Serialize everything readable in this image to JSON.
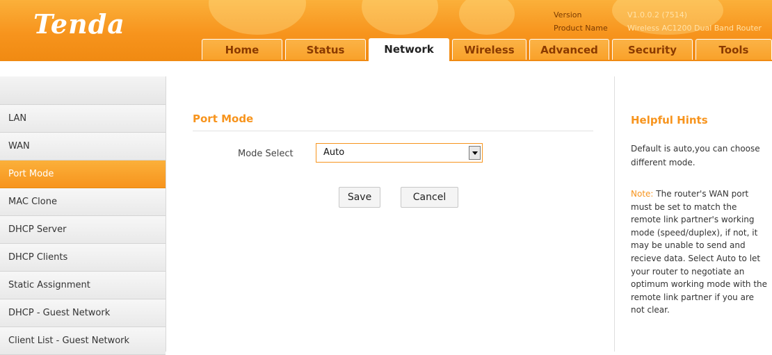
{
  "brand": {
    "logo_text": "Tenda",
    "accent_color": "#f7941d"
  },
  "info": {
    "version_label": "Version",
    "version_value": "V1.0.0.2 (7514)",
    "product_label": "Product Name",
    "product_value": "Wireless AC1200 Dual Band Router"
  },
  "tabs": [
    {
      "label": "Home"
    },
    {
      "label": "Status"
    },
    {
      "label": "Network"
    },
    {
      "label": "Wireless"
    },
    {
      "label": "Advanced"
    },
    {
      "label": "Security"
    },
    {
      "label": "Tools"
    }
  ],
  "active_tab": "Network",
  "sidebar": {
    "items": [
      {
        "label": "LAN"
      },
      {
        "label": "WAN"
      },
      {
        "label": "Port Mode"
      },
      {
        "label": "MAC Clone"
      },
      {
        "label": "DHCP Server"
      },
      {
        "label": "DHCP Clients"
      },
      {
        "label": "Static Assignment"
      },
      {
        "label": "DHCP - Guest Network"
      },
      {
        "label": "Client List - Guest Network"
      }
    ],
    "active_item": "Port Mode"
  },
  "main": {
    "title": "Port Mode",
    "mode_label": "Mode Select",
    "mode_value": "Auto",
    "save_label": "Save",
    "cancel_label": "Cancel"
  },
  "hints": {
    "title": "Helpful Hints",
    "text": "Default is auto,you can choose different mode.",
    "note_label": "Note:",
    "note_text": " The router's WAN port must be set to match the remote link partner's working mode (speed/duplex), if not, it may be unable to send and recieve data. Select Auto to let your router to negotiate an optimum working mode with the remote link partner if you are not clear."
  }
}
